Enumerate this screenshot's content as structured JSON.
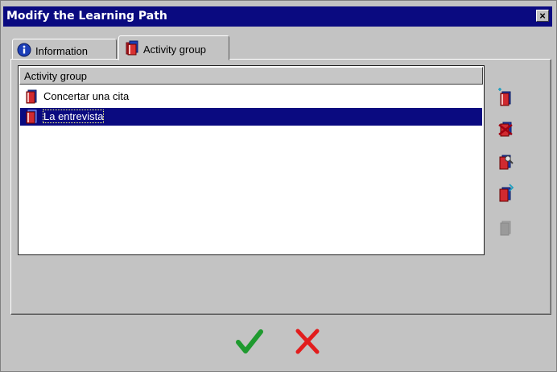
{
  "window": {
    "title": "Modify the Learning Path",
    "close_glyph": "×"
  },
  "tabs": [
    {
      "label": "Information",
      "icon": "info-icon",
      "active": false
    },
    {
      "label": "Activity group",
      "icon": "book-icon",
      "active": true
    }
  ],
  "list": {
    "header": "Activity group",
    "rows": [
      {
        "label": "Concertar una cita",
        "icon": "book-icon",
        "selected": false
      },
      {
        "label": "La entrevista",
        "icon": "book-icon",
        "selected": true
      }
    ]
  },
  "side_toolbar": [
    {
      "icon": "add-group-icon",
      "enabled": true
    },
    {
      "icon": "delete-group-icon",
      "enabled": true
    },
    {
      "icon": "edit-group-icon",
      "enabled": true
    },
    {
      "icon": "move-group-icon",
      "enabled": true
    },
    {
      "icon": "disabled-group-icon",
      "enabled": false
    }
  ],
  "footer": {
    "ok_icon": "checkmark-icon",
    "cancel_icon": "x-cancel-icon",
    "colors": {
      "ok": "#1f9a2f",
      "cancel": "#e21d1d"
    }
  },
  "colors": {
    "titlebar": "#0a0a80",
    "selection": "#0a0a80",
    "face": "#c3c3c3"
  }
}
